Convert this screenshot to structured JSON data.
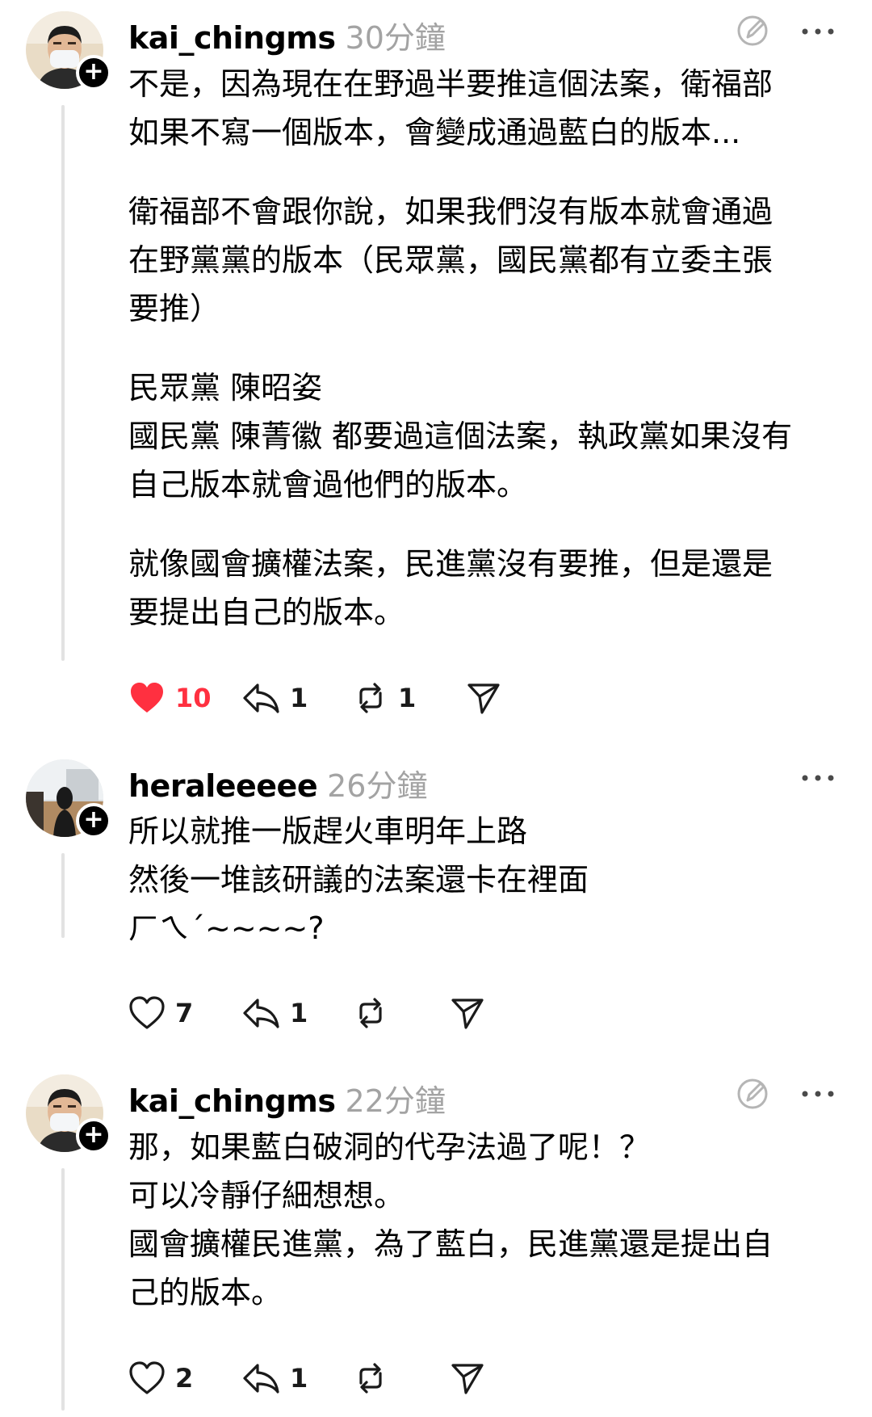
{
  "colors": {
    "like_active": "#ff3040",
    "timestamp": "#a3a3a3",
    "thread_line": "#e2e2e2",
    "icon": "#1a1a1a"
  },
  "posts": [
    {
      "username": "kai_chingms",
      "time": "30分鐘",
      "paragraphs": [
        [
          "不是，因為現在在野過半要推這個法案，衛福部",
          "如果不寫一個版本，會變成通過藍白的版本..."
        ],
        [
          "衛福部不會跟你說，如果我們沒有版本就會通過",
          "在野黨黨的版本（民眾黨，國民黨都有立委主張",
          "要推）"
        ],
        [
          "民眾黨 陳昭姿",
          "國民黨 陳菁徽 都要過這個法案，執政黨如果沒有",
          "自己版本就會過他們的版本。"
        ],
        [
          "就像國會擴權法案，民進黨沒有要推，但是還是",
          "要提出自己的版本。"
        ]
      ],
      "likes": "10",
      "replies": "1",
      "reposts": "1",
      "liked": true,
      "icons": [
        "heart-icon",
        "reply-icon",
        "repost-icon",
        "share-icon",
        "edit-icon",
        "more-icon",
        "plus-icon"
      ]
    },
    {
      "username": "heraleeeee",
      "time": "26分鐘",
      "paragraphs": [
        [
          "所以就推一版趕火車明年上路",
          "然後一堆該研議的法案還卡在裡面",
          "ㄏㄟˊ~~~~?"
        ]
      ],
      "likes": "7",
      "replies": "1",
      "reposts": "",
      "liked": false
    },
    {
      "username": "kai_chingms",
      "time": "22分鐘",
      "paragraphs": [
        [
          "那，如果藍白破洞的代孕法過了呢！？",
          "可以冷靜仔細想想。",
          "國會擴權民進黨，為了藍白，民進黨還是提出自",
          "己的版本。"
        ]
      ],
      "likes": "2",
      "replies": "1",
      "reposts": "",
      "liked": false
    }
  ]
}
